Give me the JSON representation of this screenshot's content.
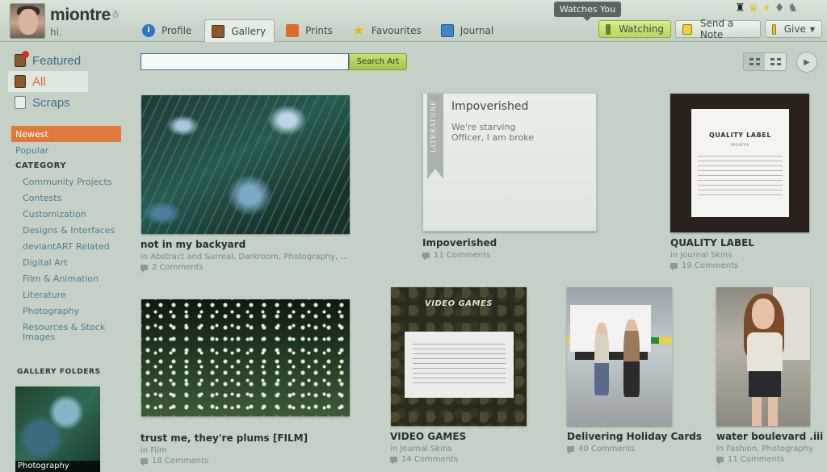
{
  "header": {
    "username": "miontre",
    "user_symbol": "☃",
    "greeting": "hi.",
    "tabs": [
      {
        "label": "Profile",
        "icon": "info-icon"
      },
      {
        "label": "Gallery",
        "icon": "gallery-icon",
        "active": true
      },
      {
        "label": "Prints",
        "icon": "prints-icon"
      },
      {
        "label": "Favourites",
        "icon": "star-icon"
      },
      {
        "label": "Journal",
        "icon": "journal-icon"
      }
    ],
    "tooltip": "Watches You",
    "buttons": {
      "watching": "Watching",
      "send_note": "Send a Note",
      "give": "Give"
    },
    "colors": {
      "accent_green": "#b6d65a",
      "accent_orange": "#e0692a",
      "link_blue": "#4d7d8f"
    }
  },
  "sidebar": {
    "nav": [
      {
        "label": "Featured"
      },
      {
        "label": "All",
        "active": true
      },
      {
        "label": "Scraps"
      }
    ],
    "sort": [
      {
        "label": "Newest",
        "active": true
      },
      {
        "label": "Popular"
      }
    ],
    "category_heading": "CATEGORY",
    "categories": [
      "Community Projects",
      "Contests",
      "Customization",
      "Designs & Interfaces",
      "deviantART Related",
      "Digital Art",
      "Film & Animation",
      "Literature",
      "Photography",
      "Resources & Stock Images"
    ],
    "folders_heading": "GALLERY FOLDERS",
    "folder_label": "Photography"
  },
  "search": {
    "value": "",
    "button_label": "Search Art"
  },
  "gallery": {
    "in_label": "in",
    "items": [
      {
        "title": "not in my backyard",
        "category": "Abstract and Surreal, Darkroom, Photography, Pla...",
        "comments": "2 Comments"
      },
      {
        "title": "Impoverished",
        "category": "",
        "comments": "11 Comments",
        "card": {
          "ribbon": "LITERATURE",
          "title": "Impoverished",
          "line1": "We're starving",
          "line2": "Officer, I am broke"
        }
      },
      {
        "title": "QUALITY LABEL",
        "category": "Journal Skins",
        "comments": "19 Comments",
        "card": {
          "title": "QUALITY LABEL",
          "sub": "MIONTRE"
        }
      },
      {
        "title": "trust me, they're plums [FILM]",
        "category": "Film",
        "comments": "18 Comments"
      },
      {
        "title": "VIDEO GAMES",
        "category": "Journal Skins",
        "comments": "14 Comments",
        "card": {
          "title": "VIDEO GAMES"
        }
      },
      {
        "title": "Delivering Holiday Cards",
        "category": "",
        "comments": "40 Comments"
      },
      {
        "title": "water boulevard .iii",
        "category": "Fashion, Photography",
        "comments": "11 Comments"
      }
    ]
  }
}
